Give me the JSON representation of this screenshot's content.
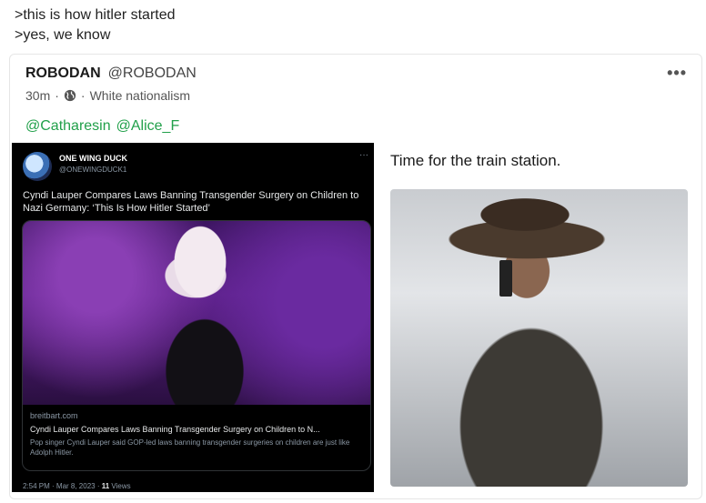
{
  "greentext": {
    "line1": ">this is how hitler started",
    "line2": ">yes, we know"
  },
  "post": {
    "author_name": "ROBODAN",
    "author_handle": "@ROBODAN",
    "time": "30m",
    "separator": "·",
    "visibility_icon": "globe-icon",
    "category": "White nationalism",
    "more_icon": "more-options-icon",
    "mentions": [
      "@Catharesin",
      "@Alice_F"
    ],
    "caption": "Time for the train station."
  },
  "embed": {
    "name": "ONE WING DUCK",
    "handle": "@ONEWINGDUCK1",
    "dots": "···",
    "text": "Cyndi Lauper Compares Laws Banning Transgender Surgery on Children to Nazi Germany: ‘This Is How Hitler Started’",
    "card_domain": "breitbart.com",
    "card_title": "Cyndi Lauper Compares Laws Banning Transgender Surgery on Children to N...",
    "card_desc": "Pop singer Cyndi Lauper said GOP-led laws banning transgender surgeries on children are just like Adolph Hitler.",
    "footer_time": "2:54 PM · Mar 8, 2023 · ",
    "footer_views": "11",
    "footer_views_label": " Views"
  },
  "colors": {
    "mention": "#21a04a",
    "embed_bg": "#000000"
  }
}
